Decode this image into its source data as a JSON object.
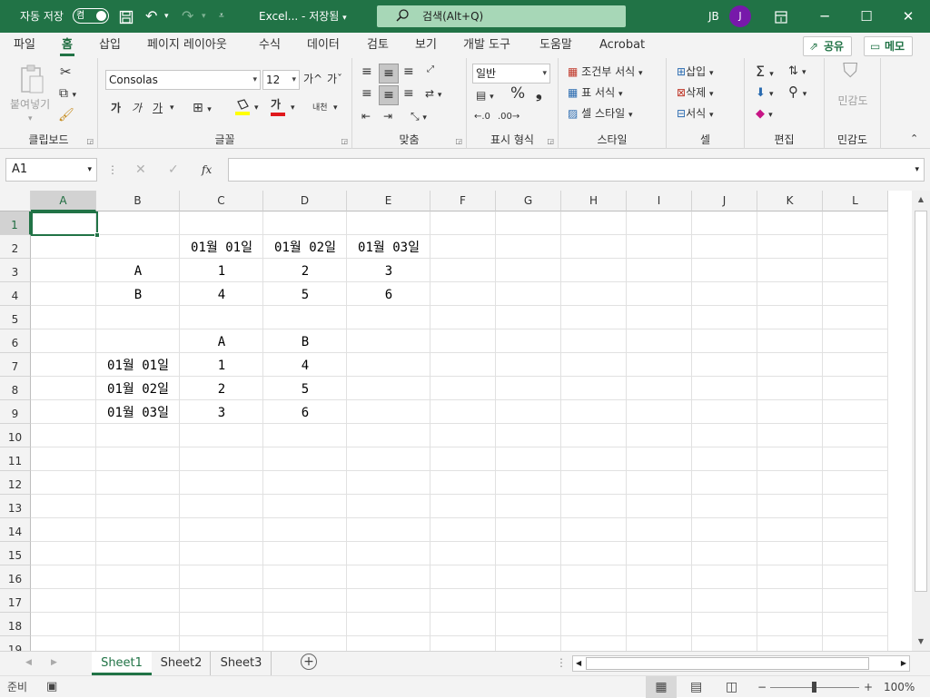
{
  "titlebar": {
    "autosave_label": "자동 저장",
    "autosave_state": "켬",
    "doc_title": "Excel... - 저장됨",
    "search_placeholder": "검색(Alt+Q)",
    "user_initials": "JB",
    "avatar_letter": "J",
    "accent_color": "#217346"
  },
  "menu": {
    "tabs": [
      "파일",
      "홈",
      "삽입",
      "페이지 레이아웃",
      "수식",
      "데이터",
      "검토",
      "보기",
      "개발 도구",
      "도움말",
      "Acrobat"
    ],
    "active_tab": "홈",
    "share_label": "공유",
    "memo_label": "메모"
  },
  "ribbon": {
    "clipboard": {
      "paste_label": "붙여넣기",
      "title": "클립보드"
    },
    "font": {
      "font_name": "Consolas",
      "font_size": "12",
      "bold": "가",
      "italic": "가",
      "underline": "가",
      "font_color_glyph": "가",
      "phonetic": "내천",
      "grow": "가^",
      "shrink": "가ˇ",
      "title": "글꼴"
    },
    "align": {
      "title": "맞춤"
    },
    "number": {
      "format": "일반",
      "title": "표시 형식"
    },
    "styles": {
      "conditional": "조건부 서식",
      "table": "표 서식",
      "cell": "셀 스타일",
      "title": "스타일"
    },
    "cells": {
      "insert": "삽입",
      "delete": "삭제",
      "format": "서식",
      "title": "셀"
    },
    "editing": {
      "title": "편집"
    },
    "sensitivity": {
      "label": "민감도",
      "title": "민감도"
    }
  },
  "formula_bar": {
    "name_box": "A1",
    "fx": "fx",
    "value": ""
  },
  "grid": {
    "columns": [
      "A",
      "B",
      "C",
      "D",
      "E",
      "F",
      "G",
      "H",
      "I",
      "J",
      "K",
      "L"
    ],
    "rows": [
      "1",
      "2",
      "3",
      "4",
      "5",
      "6",
      "7",
      "8",
      "9",
      "10",
      "11",
      "12",
      "13",
      "14",
      "15",
      "16",
      "17",
      "18",
      "19"
    ],
    "selected_cell": "A1",
    "cells": [
      {
        "ref": "C2",
        "text": "01월 01일"
      },
      {
        "ref": "D2",
        "text": "01월 02일"
      },
      {
        "ref": "E2",
        "text": "01월 03일"
      },
      {
        "ref": "B3",
        "text": "A"
      },
      {
        "ref": "C3",
        "text": "1"
      },
      {
        "ref": "D3",
        "text": "2"
      },
      {
        "ref": "E3",
        "text": "3"
      },
      {
        "ref": "B4",
        "text": "B"
      },
      {
        "ref": "C4",
        "text": "4"
      },
      {
        "ref": "D4",
        "text": "5"
      },
      {
        "ref": "E4",
        "text": "6"
      },
      {
        "ref": "C6",
        "text": "A"
      },
      {
        "ref": "D6",
        "text": "B"
      },
      {
        "ref": "B7",
        "text": "01월 01일"
      },
      {
        "ref": "C7",
        "text": "1"
      },
      {
        "ref": "D7",
        "text": "4"
      },
      {
        "ref": "B8",
        "text": "01월 02일"
      },
      {
        "ref": "C8",
        "text": "2"
      },
      {
        "ref": "D8",
        "text": "5"
      },
      {
        "ref": "B9",
        "text": "01월 03일"
      },
      {
        "ref": "C9",
        "text": "3"
      },
      {
        "ref": "D9",
        "text": "6"
      }
    ]
  },
  "sheets": {
    "tabs": [
      "Sheet1",
      "Sheet2",
      "Sheet3"
    ],
    "active": "Sheet1"
  },
  "status": {
    "ready": "준비",
    "zoom": "100%"
  }
}
